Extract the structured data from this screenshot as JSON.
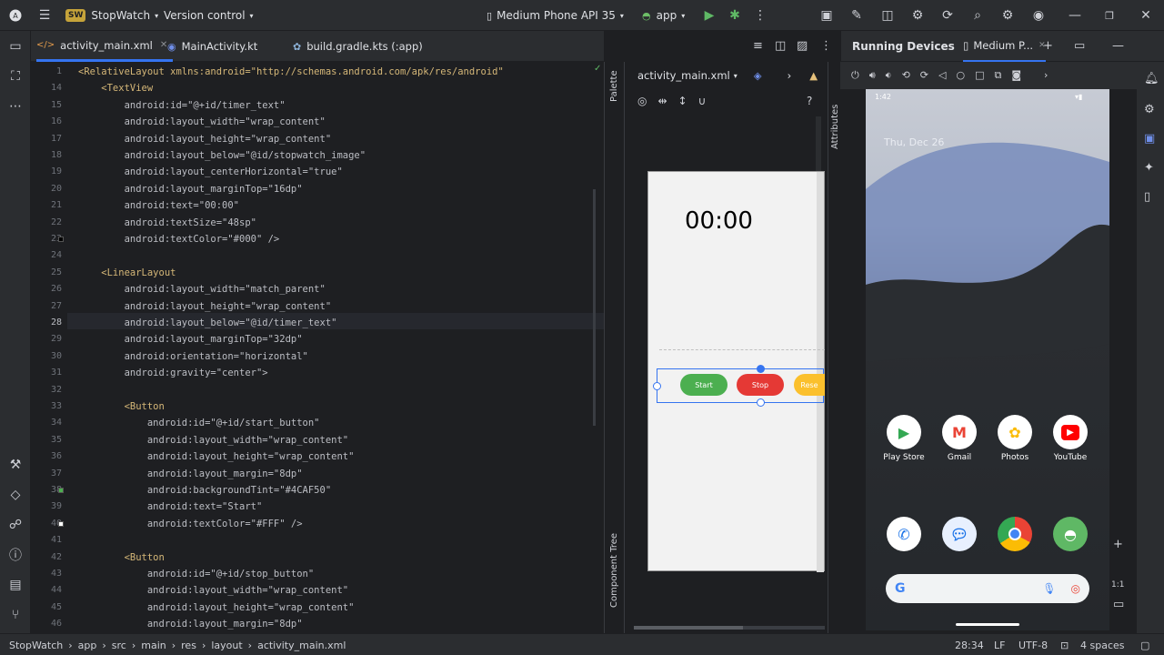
{
  "titlebar": {
    "project_badge": "SW",
    "project": "StopWatch",
    "vcs": "Version control",
    "device": "Medium Phone API 35",
    "run_config": "app"
  },
  "tabs": [
    {
      "label": "activity_main.xml"
    },
    {
      "label": "MainActivity.kt"
    },
    {
      "label": "build.gradle.kts (:app)"
    }
  ],
  "editor": {
    "lines": [
      {
        "n": "1",
        "text": "<RelativeLayout xmlns:android=\"http://schemas.android.com/apk/res/android\""
      },
      {
        "n": "14",
        "text": "    <TextView"
      },
      {
        "n": "15",
        "text": "        android:id=\"@+id/timer_text\""
      },
      {
        "n": "16",
        "text": "        android:layout_width=\"wrap_content\""
      },
      {
        "n": "17",
        "text": "        android:layout_height=\"wrap_content\""
      },
      {
        "n": "18",
        "text": "        android:layout_below=\"@id/stopwatch_image\""
      },
      {
        "n": "19",
        "text": "        android:layout_centerHorizontal=\"true\""
      },
      {
        "n": "20",
        "text": "        android:layout_marginTop=\"16dp\""
      },
      {
        "n": "21",
        "text": "        android:text=\"00:00\""
      },
      {
        "n": "22",
        "text": "        android:textSize=\"48sp\""
      },
      {
        "n": "23",
        "text": "        android:textColor=\"#000\" />"
      },
      {
        "n": "24",
        "text": ""
      },
      {
        "n": "25",
        "text": "    <LinearLayout"
      },
      {
        "n": "26",
        "text": "        android:layout_width=\"match_parent\""
      },
      {
        "n": "27",
        "text": "        android:layout_height=\"wrap_content\""
      },
      {
        "n": "28",
        "text": "        android:layout_below=\"@id/timer_text\""
      },
      {
        "n": "29",
        "text": "        android:layout_marginTop=\"32dp\""
      },
      {
        "n": "30",
        "text": "        android:orientation=\"horizontal\""
      },
      {
        "n": "31",
        "text": "        android:gravity=\"center\">"
      },
      {
        "n": "32",
        "text": ""
      },
      {
        "n": "33",
        "text": "        <Button"
      },
      {
        "n": "34",
        "text": "            android:id=\"@+id/start_button\""
      },
      {
        "n": "35",
        "text": "            android:layout_width=\"wrap_content\""
      },
      {
        "n": "36",
        "text": "            android:layout_height=\"wrap_content\""
      },
      {
        "n": "37",
        "text": "            android:layout_margin=\"8dp\""
      },
      {
        "n": "38",
        "text": "            android:backgroundTint=\"#4CAF50\""
      },
      {
        "n": "39",
        "text": "            android:text=\"Start\""
      },
      {
        "n": "40",
        "text": "            android:textColor=\"#FFF\" />"
      },
      {
        "n": "41",
        "text": ""
      },
      {
        "n": "42",
        "text": "        <Button"
      },
      {
        "n": "43",
        "text": "            android:id=\"@+id/stop_button\""
      },
      {
        "n": "44",
        "text": "            android:layout_width=\"wrap_content\""
      },
      {
        "n": "45",
        "text": "            android:layout_height=\"wrap_content\""
      },
      {
        "n": "46",
        "text": "            android:layout_margin=\"8dp\""
      }
    ],
    "current_line": "28"
  },
  "preview": {
    "file": "activity_main.xml",
    "palette": "Palette",
    "attributes": "Attributes",
    "component_tree": "Component Tree",
    "timer": "00:00",
    "buttons": [
      {
        "label": "Start",
        "color": "#4CAF50"
      },
      {
        "label": "Stop",
        "color": "#E53935"
      },
      {
        "label": "Rese",
        "color": "#FBC02D"
      }
    ],
    "zoom": "1:1"
  },
  "running_devices": {
    "title": "Running Devices",
    "device_tab": "Medium P...",
    "phone_time": "1:42",
    "phone_date": "Thu, Dec 26",
    "apps": [
      {
        "label": "Play Store",
        "icon": "play-store-icon"
      },
      {
        "label": "Gmail",
        "icon": "gmail-icon"
      },
      {
        "label": "Photos",
        "icon": "photos-icon"
      },
      {
        "label": "YouTube",
        "icon": "youtube-icon"
      }
    ]
  },
  "statusbar": {
    "crumbs": [
      "StopWatch",
      "app",
      "src",
      "main",
      "res",
      "layout",
      "activity_main.xml"
    ],
    "position": "28:34",
    "line_sep": "LF",
    "encoding": "UTF-8",
    "indent": "4 spaces"
  }
}
